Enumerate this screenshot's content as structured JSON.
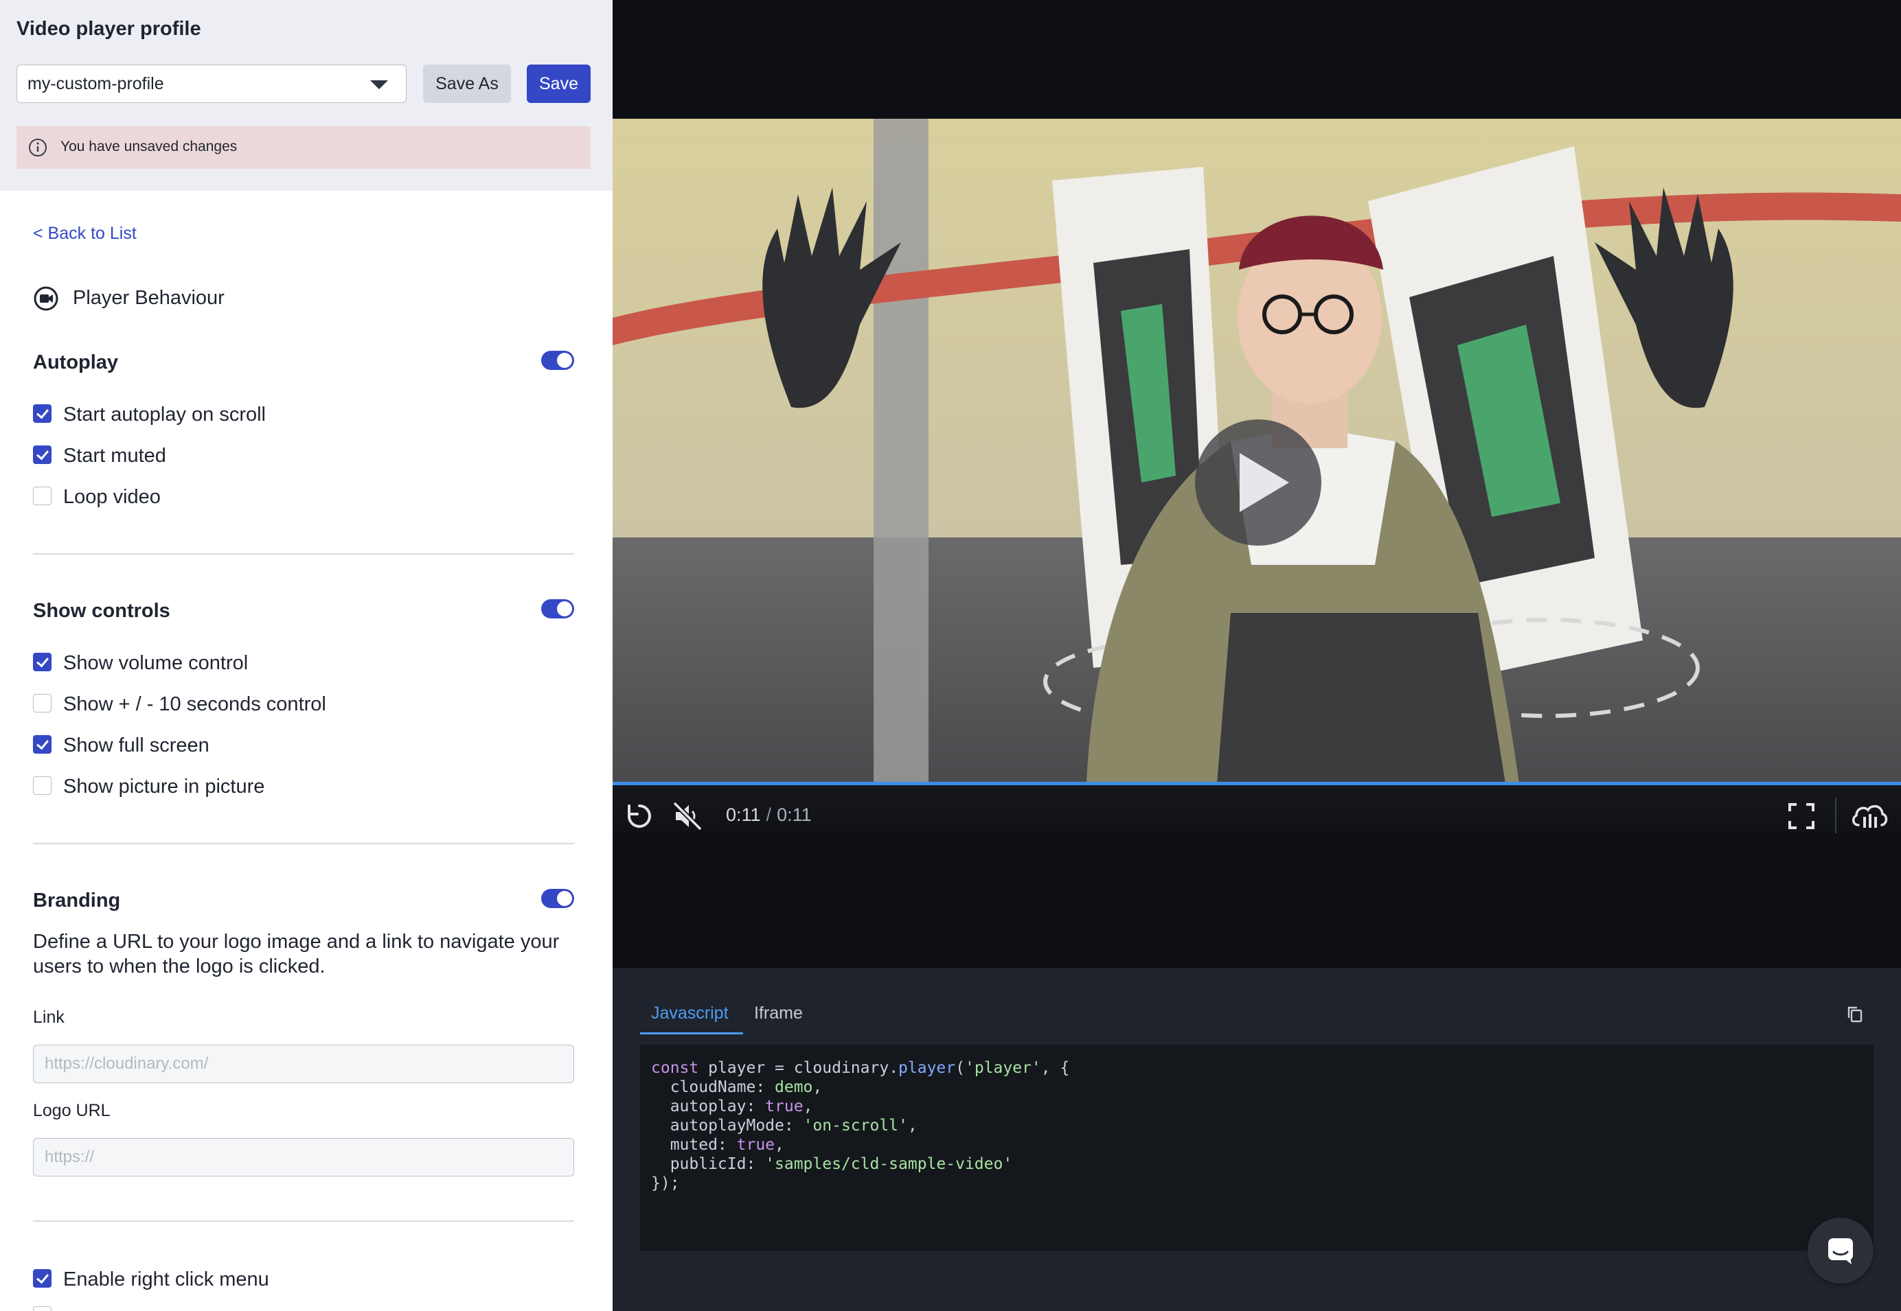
{
  "header": {
    "title": "Video player profile",
    "profile_select": {
      "value": "my-custom-profile"
    },
    "save_as_label": "Save As",
    "save_label": "Save",
    "unsaved_notice": "You have unsaved changes"
  },
  "nav": {
    "back_link": "< Back to List"
  },
  "section": {
    "title": "Player Behaviour",
    "icon": "video-camera-icon"
  },
  "autoplay": {
    "title": "Autoplay",
    "enabled": true,
    "options": [
      {
        "label": "Start autoplay on scroll",
        "checked": true
      },
      {
        "label": "Start muted",
        "checked": true
      },
      {
        "label": "Loop video",
        "checked": false
      }
    ]
  },
  "controls_group": {
    "title": "Show controls",
    "enabled": true,
    "options": [
      {
        "label": "Show volume control",
        "checked": true
      },
      {
        "label": "Show + / - 10 seconds control",
        "checked": false
      },
      {
        "label": "Show full screen",
        "checked": true
      },
      {
        "label": "Show picture in picture",
        "checked": false
      }
    ]
  },
  "branding": {
    "title": "Branding",
    "enabled": true,
    "description": "Define a URL to your logo image and a link to navigate your users to when the logo is clicked.",
    "link_label": "Link",
    "link_placeholder": "https://cloudinary.com/",
    "logo_label": "Logo URL",
    "logo_placeholder": "https://"
  },
  "extra": {
    "right_click": {
      "label": "Enable right click menu",
      "checked": true
    }
  },
  "player": {
    "current_time": "0:11",
    "separator": "/",
    "duration": "0:11",
    "progress": 1.0,
    "icons": [
      "replay-icon",
      "muted-volume-icon",
      "play-icon",
      "fullscreen-icon",
      "cloudinary-logo-icon"
    ]
  },
  "code": {
    "tabs": [
      "Javascript",
      "Iframe"
    ],
    "active_tab": "Javascript",
    "lines": [
      "const player = cloudinary.player('player', {",
      "  cloudName: demo,",
      "  autoplay: true,",
      "  autoplayMode: 'on-scroll',",
      "  muted: true,",
      "  publicId: 'samples/cld-sample-video'",
      "});"
    ]
  },
  "colors": {
    "accent": "#3448c5",
    "notice_bg": "#ecd8db",
    "progress": "#3a8fea",
    "tab_active": "#4c9ef2"
  }
}
